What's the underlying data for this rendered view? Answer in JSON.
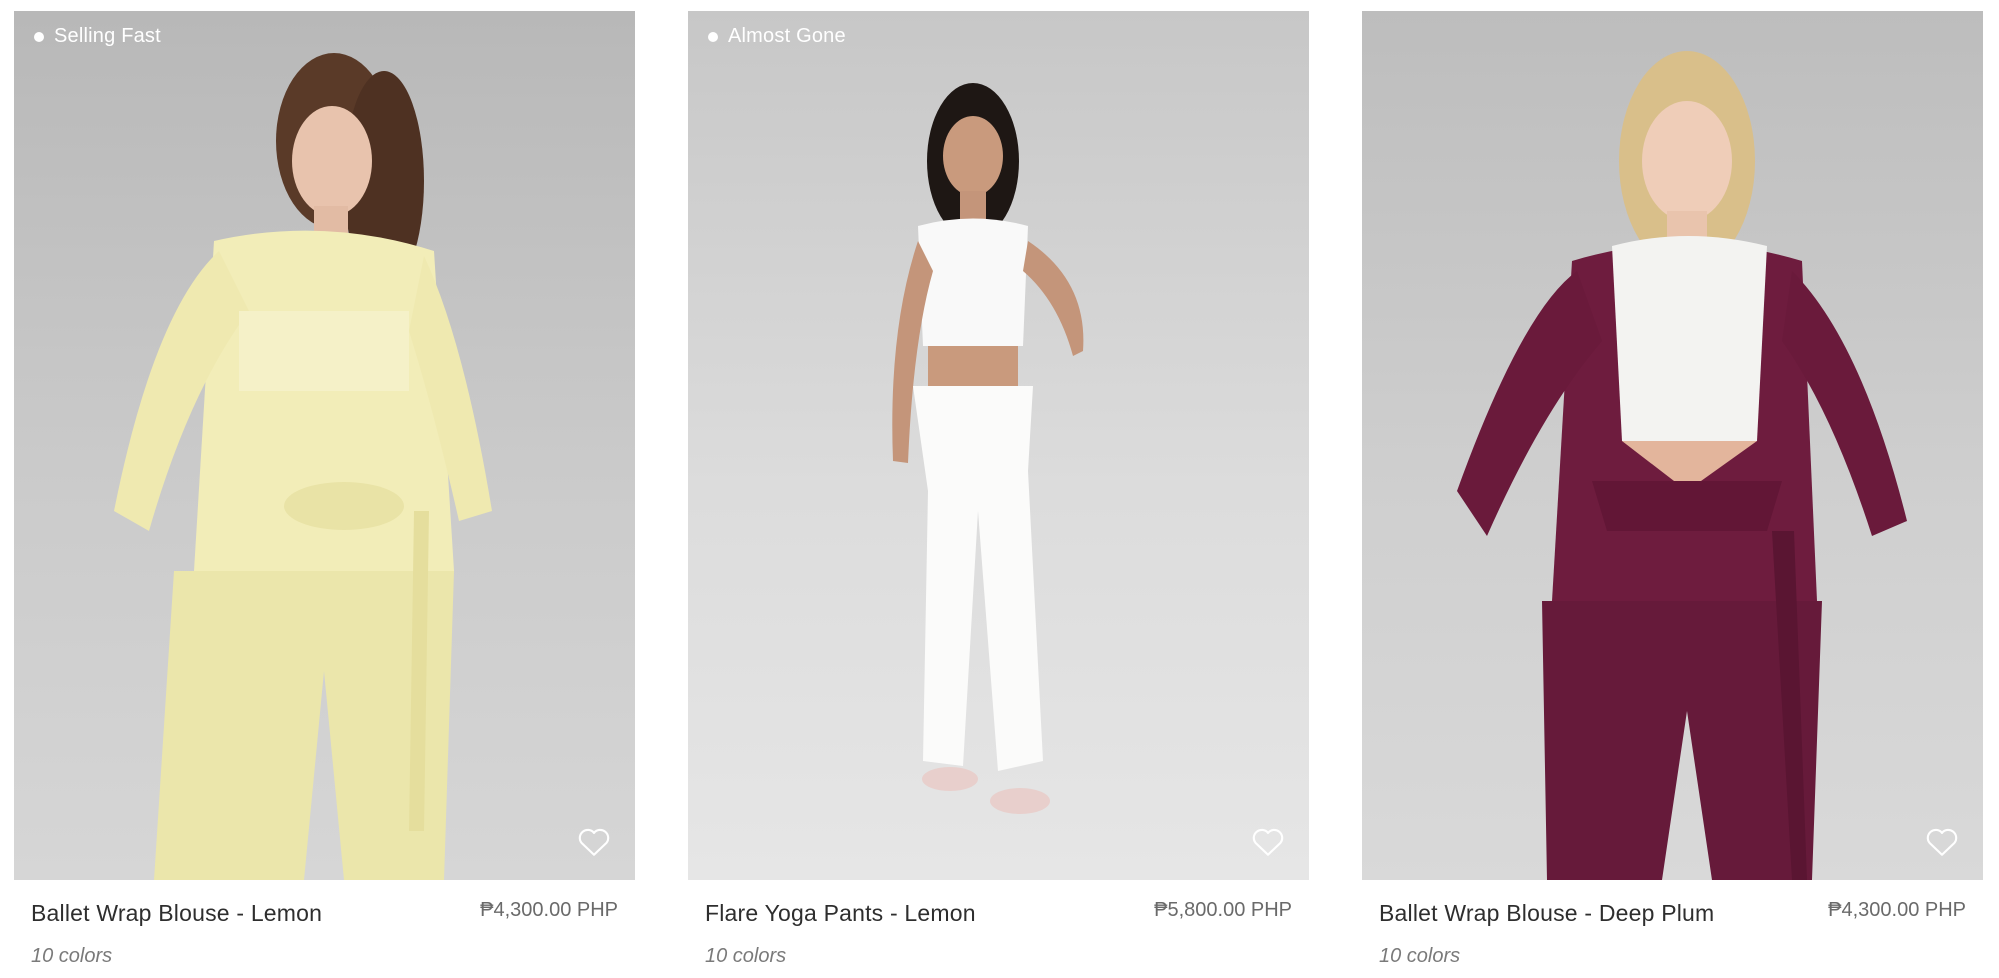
{
  "products": [
    {
      "badge": "Selling Fast",
      "name": "Ballet Wrap Blouse - Lemon",
      "price": "₱4,300.00 PHP",
      "colors": "10 colors",
      "garment_color": "#f1ecb5",
      "icon": "heart-outline-icon"
    },
    {
      "badge": "Almost Gone",
      "name": "Flare Yoga Pants - Lemon",
      "price": "₱5,800.00 PHP",
      "colors": "10 colors",
      "garment_color": "#f7f7f5",
      "icon": "heart-outline-icon"
    },
    {
      "badge": "",
      "name": "Ballet Wrap Blouse - Deep Plum",
      "price": "₱4,300.00 PHP",
      "colors": "10 colors",
      "garment_color": "#6e1c3e",
      "icon": "heart-outline-icon"
    }
  ]
}
